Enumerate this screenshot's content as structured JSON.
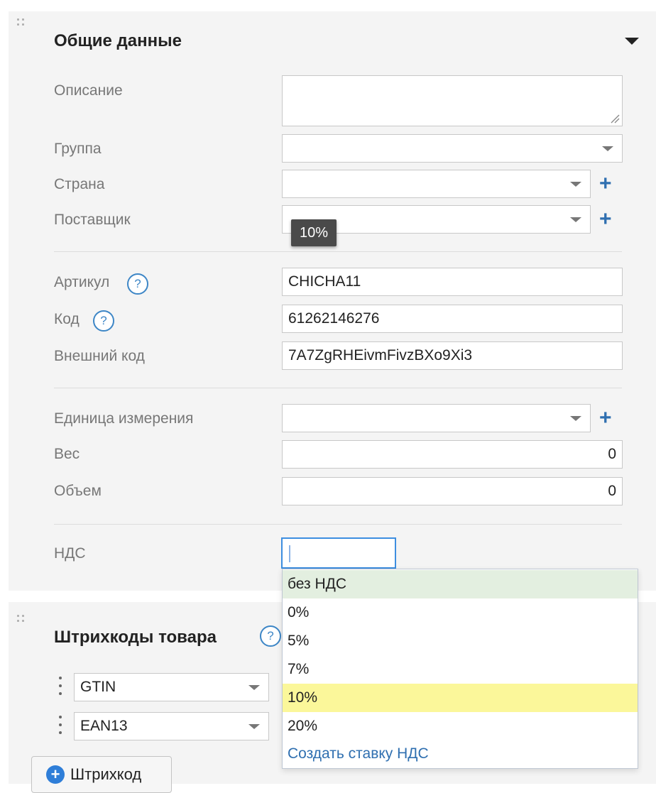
{
  "general": {
    "title": "Общие данные",
    "description": {
      "label": "Описание",
      "value": ""
    },
    "group": {
      "label": "Группа",
      "value": ""
    },
    "country": {
      "label": "Страна",
      "value": ""
    },
    "supplier": {
      "label": "Поставщик",
      "value": ""
    },
    "article": {
      "label": "Артикул",
      "value": "CHICHA11"
    },
    "code": {
      "label": "Код",
      "value": "61262146276"
    },
    "external_code": {
      "label": "Внешний код",
      "value": "7A7ZgRHEivmFivzBXo9Xi3"
    },
    "unit": {
      "label": "Единица измерения",
      "value": ""
    },
    "weight": {
      "label": "Вес",
      "value": "0"
    },
    "volume": {
      "label": "Объем",
      "value": "0"
    },
    "vat": {
      "label": "НДС",
      "value": ""
    },
    "help_glyph": "?",
    "plus_glyph": "+"
  },
  "tooltip": {
    "text": "10%"
  },
  "vat_dropdown": {
    "options": [
      "без НДС",
      "0%",
      "5%",
      "7%",
      "10%",
      "20%"
    ],
    "selected": "без НДС",
    "hovered": "10%",
    "create_label": "Создать ставку НДС"
  },
  "barcodes": {
    "title": "Штрихкоды товара",
    "rows": [
      {
        "type": "GTIN"
      },
      {
        "type": "EAN13"
      }
    ],
    "add_button_label": "Штрихкод",
    "add_button_glyph": "+"
  },
  "colors": {
    "accent": "#2f6fb0",
    "focus_border": "#3d8ee0",
    "highlight": "#fbf79a",
    "selected": "#e3efe0"
  }
}
